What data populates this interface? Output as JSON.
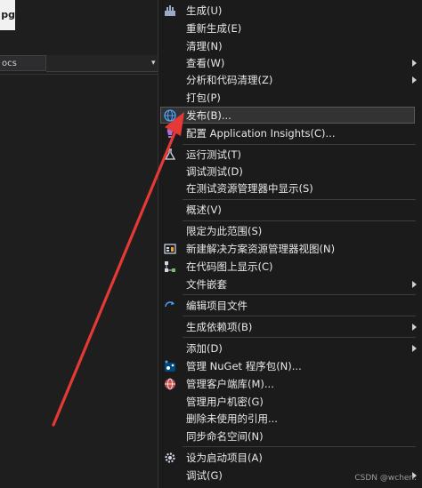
{
  "left": {
    "tab_title": "pg",
    "docs_label": "ocs",
    "dropdown_glyph": "▾"
  },
  "menu": {
    "items": [
      {
        "label": "生成(U)",
        "icon": "build-icon",
        "arrow": false
      },
      {
        "label": "重新生成(E)",
        "icon": "",
        "arrow": false
      },
      {
        "label": "清理(N)",
        "icon": "",
        "arrow": false
      },
      {
        "label": "查看(W)",
        "icon": "",
        "arrow": true
      },
      {
        "label": "分析和代码清理(Z)",
        "icon": "",
        "arrow": true
      },
      {
        "label": "打包(P)",
        "icon": "",
        "arrow": false
      },
      {
        "label": "发布(B)...",
        "icon": "publish-globe-icon",
        "arrow": false,
        "highlighted": true
      },
      {
        "label": "配置 Application Insights(C)...",
        "icon": "insights-icon",
        "arrow": false
      },
      {
        "label": "运行测试(T)",
        "icon": "test-flask-icon",
        "arrow": false
      },
      {
        "label": "调试测试(D)",
        "icon": "",
        "arrow": false
      },
      {
        "label": "在测试资源管理器中显示(S)",
        "icon": "",
        "arrow": false
      },
      {
        "label": "概述(V)",
        "icon": "",
        "arrow": false
      },
      {
        "label": "限定为此范围(S)",
        "icon": "",
        "arrow": false
      },
      {
        "label": "新建解决方案资源管理器视图(N)",
        "icon": "new-view-icon",
        "arrow": false
      },
      {
        "label": "在代码图上显示(C)",
        "icon": "code-map-icon",
        "arrow": false
      },
      {
        "label": "文件嵌套",
        "icon": "",
        "arrow": true
      },
      {
        "label": "编辑项目文件",
        "icon": "edit-arrow-icon",
        "arrow": false
      },
      {
        "label": "生成依赖项(B)",
        "icon": "",
        "arrow": true
      },
      {
        "label": "添加(D)",
        "icon": "",
        "arrow": true
      },
      {
        "label": "管理 NuGet 程序包(N)...",
        "icon": "nuget-icon",
        "arrow": false
      },
      {
        "label": "管理客户端库(M)...",
        "icon": "client-library-icon",
        "arrow": false
      },
      {
        "label": "管理用户机密(G)",
        "icon": "",
        "arrow": false
      },
      {
        "label": "删除未使用的引用...",
        "icon": "",
        "arrow": false
      },
      {
        "label": "同步命名空间(N)",
        "icon": "",
        "arrow": false
      },
      {
        "label": "设为启动项目(A)",
        "icon": "gear-icon",
        "arrow": false
      },
      {
        "label": "调试(G)",
        "icon": "",
        "arrow": true
      }
    ]
  },
  "watermark": "CSDN @wchen.",
  "colors": {
    "annotation_arrow": "#e53935",
    "highlight_border": "#5a5a5e",
    "menu_background": "#1b1b1c"
  }
}
